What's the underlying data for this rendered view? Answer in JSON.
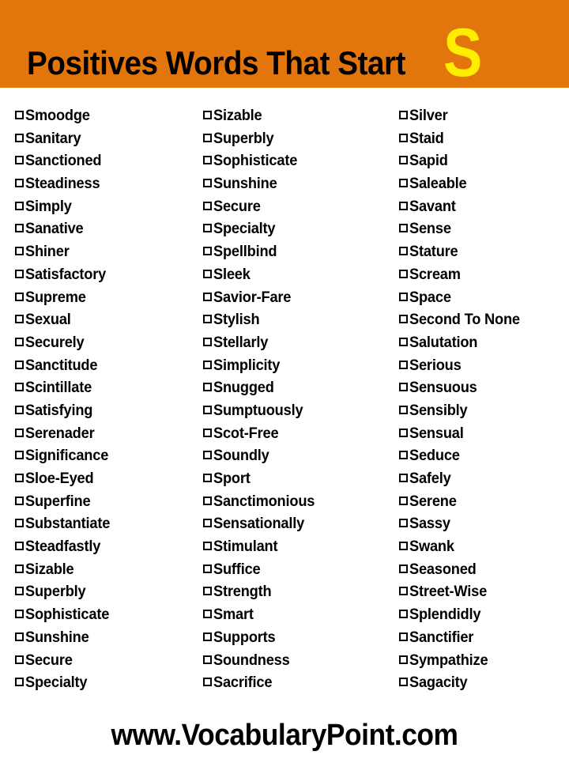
{
  "header": {
    "title": "Positives Words That Start",
    "letter": "S",
    "background_color": "#e3750d",
    "title_color": "#000000",
    "letter_color": "#ffee00"
  },
  "checkbox_icon": "empty-checkbox",
  "columns": [
    {
      "id": "column-1",
      "items": [
        "Smoodge",
        "Sanitary",
        "Sanctioned",
        "Steadiness",
        "Simply",
        "Sanative",
        "Shiner",
        "Satisfactory",
        "Supreme",
        "Sexual",
        "Securely",
        "Sanctitude",
        "Scintillate",
        "Satisfying",
        "Serenader",
        "Significance",
        "Sloe-Eyed",
        "Superfine",
        "Substantiate",
        "Steadfastly",
        "Sizable",
        "Superbly",
        "Sophisticate",
        "Sunshine",
        "Secure",
        "Specialty"
      ]
    },
    {
      "id": "column-2",
      "items": [
        "Sizable",
        "Superbly",
        "Sophisticate",
        "Sunshine",
        "Secure",
        "Specialty",
        "Spellbind",
        "Sleek",
        "Savior-Fare",
        "Stylish",
        "Stellarly",
        "Simplicity",
        "Snugged",
        "Sumptuously",
        "Scot-Free",
        "Soundly",
        "Sport",
        "Sanctimonious",
        "Sensationally",
        "Stimulant",
        "Suffice",
        "Strength",
        "Smart",
        "Supports",
        "Soundness",
        "Sacrifice"
      ]
    },
    {
      "id": "column-3",
      "items": [
        "Silver",
        "Staid",
        "Sapid",
        "Saleable",
        "Savant",
        "Sense",
        "Stature",
        "Scream",
        "Space",
        "Second To None",
        "Salutation",
        "Serious",
        "Sensuous",
        "Sensibly",
        "Sensual",
        "Seduce",
        "Safely",
        "Serene",
        "Sassy",
        "Swank",
        "Seasoned",
        "Street-Wise",
        "Splendidly",
        "Sanctifier",
        "Sympathize",
        "Sagacity"
      ]
    }
  ],
  "footer": {
    "website": "www.VocabularyPoint.com"
  }
}
